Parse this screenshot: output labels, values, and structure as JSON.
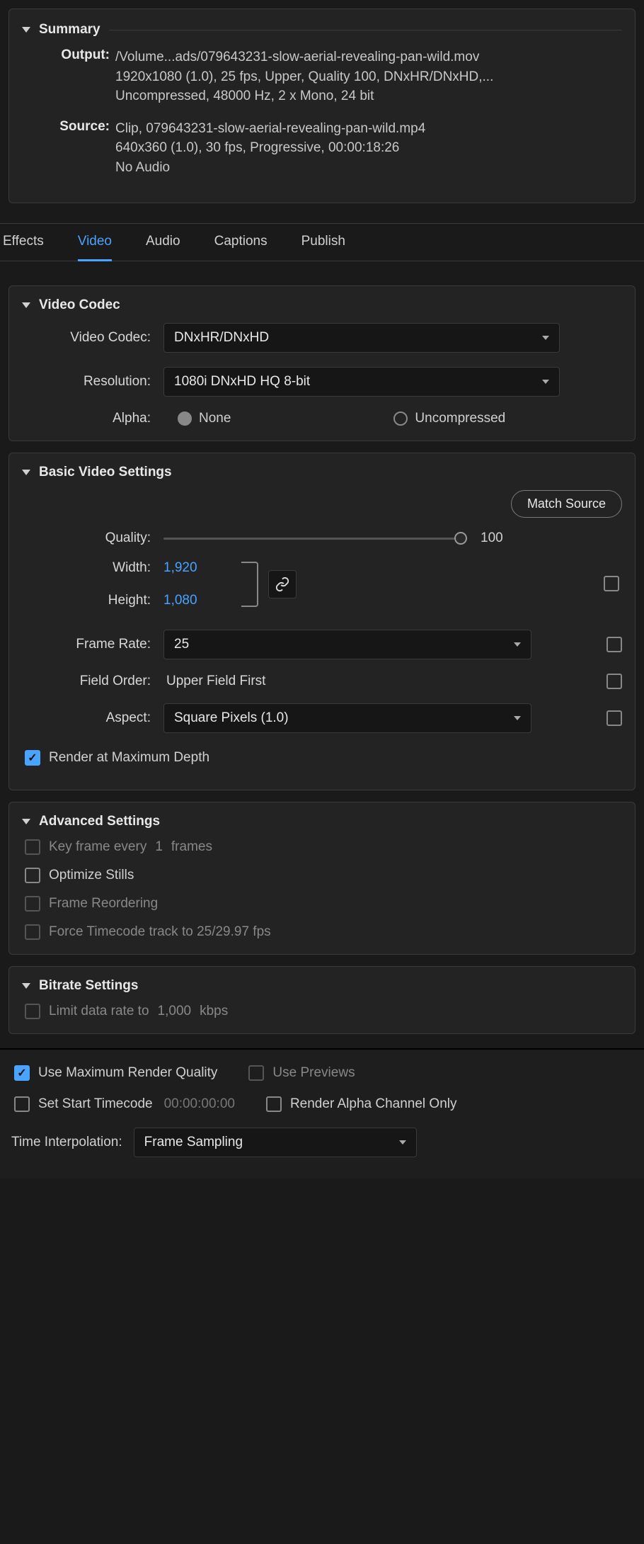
{
  "summary": {
    "title": "Summary",
    "output": {
      "label": "Output:",
      "line1": "/Volume...ads/079643231-slow-aerial-revealing-pan-wild.mov",
      "line2": "1920x1080 (1.0), 25 fps, Upper, Quality 100, DNxHR/DNxHD,...",
      "line3": "Uncompressed, 48000 Hz, 2 x Mono, 24 bit"
    },
    "source": {
      "label": "Source:",
      "line1": "Clip, 079643231-slow-aerial-revealing-pan-wild.mp4",
      "line2": "640x360 (1.0), 30 fps, Progressive, 00:00:18:26",
      "line3": "No Audio"
    }
  },
  "tabs": {
    "effects": "Effects",
    "video": "Video",
    "audio": "Audio",
    "captions": "Captions",
    "publish": "Publish"
  },
  "videoCodec": {
    "title": "Video Codec",
    "codecLabel": "Video Codec:",
    "codecValue": "DNxHR/DNxHD",
    "resolutionLabel": "Resolution:",
    "resolutionValue": "1080i DNxHD HQ 8-bit",
    "alphaLabel": "Alpha:",
    "alphaNone": "None",
    "alphaUncompressed": "Uncompressed"
  },
  "basic": {
    "title": "Basic Video Settings",
    "matchSource": "Match Source",
    "qualityLabel": "Quality:",
    "qualityValue": "100",
    "widthLabel": "Width:",
    "widthValue": "1,920",
    "heightLabel": "Height:",
    "heightValue": "1,080",
    "frameRateLabel": "Frame Rate:",
    "frameRateValue": "25",
    "fieldOrderLabel": "Field Order:",
    "fieldOrderValue": "Upper Field First",
    "aspectLabel": "Aspect:",
    "aspectValue": "Square Pixels (1.0)",
    "renderMaxDepth": "Render at Maximum Depth"
  },
  "advanced": {
    "title": "Advanced Settings",
    "keyframePre": "Key frame every",
    "keyframeVal": "1",
    "keyframePost": "frames",
    "optimizeStills": "Optimize Stills",
    "frameReorder": "Frame Reordering",
    "forceTimecode": "Force Timecode track to 25/29.97 fps"
  },
  "bitrate": {
    "title": "Bitrate Settings",
    "limitLabel": "Limit data rate to",
    "limitValue": "1,000",
    "limitUnit": "kbps"
  },
  "footer": {
    "useMaxQuality": "Use Maximum Render Quality",
    "usePreviews": "Use Previews",
    "setStartTC": "Set Start Timecode",
    "tcValue": "00:00:00:00",
    "renderAlphaOnly": "Render Alpha Channel Only",
    "timeInterpLabel": "Time Interpolation:",
    "timeInterpValue": "Frame Sampling"
  }
}
